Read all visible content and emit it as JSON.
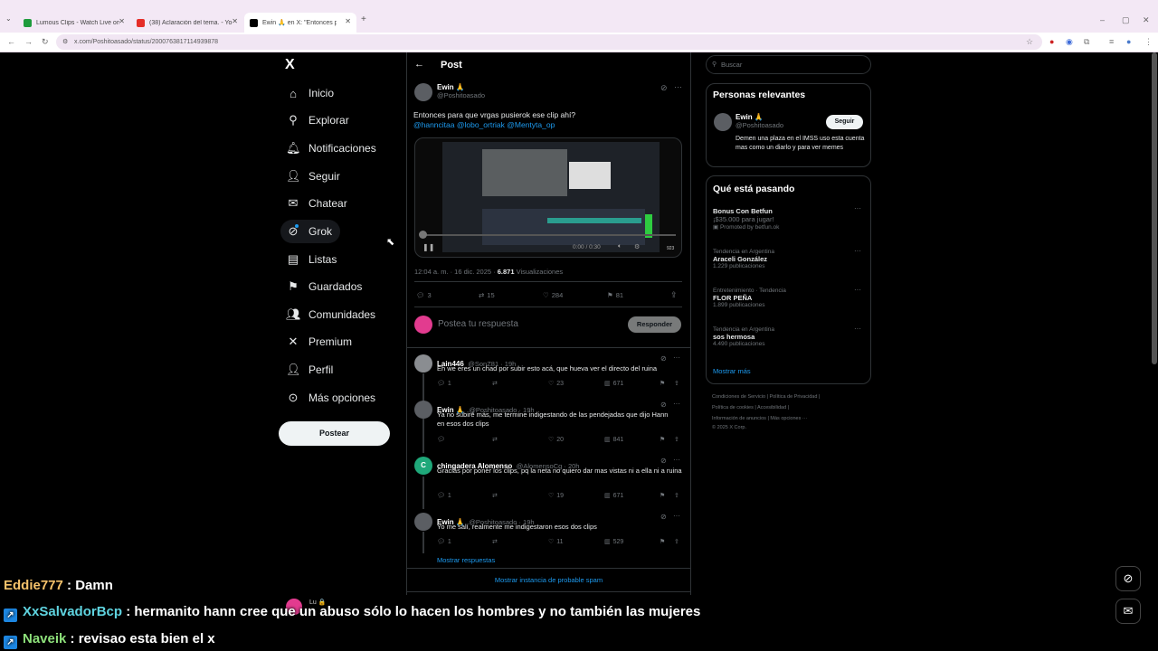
{
  "browser": {
    "tabs": [
      {
        "title": "Lumous Clips - Watch Live on X"
      },
      {
        "title": "(38) Aclaración del tema. - YouTube"
      },
      {
        "title": "Ewin 🙏 en X: \"Entonces para que"
      }
    ],
    "url": "x.com/Poshitoasado/status/2000763817114939878"
  },
  "nav": {
    "logo": "X",
    "items": [
      "Inicio",
      "Explorar",
      "Notificaciones",
      "Seguir",
      "Chatear",
      "Grok",
      "Listas",
      "Guardados",
      "Comunidades",
      "Premium",
      "Perfil",
      "Más opciones"
    ],
    "post_label": "Postear"
  },
  "header": {
    "title": "Post"
  },
  "post": {
    "name": "Ewin 🙏",
    "handle": "@Poshitoasado",
    "text": "Entonces para que vrgas pusierok ese clip ahí?",
    "mentions": "@hanncitaa @lobo_ortriak @Mentyta_op",
    "video_time": "0:00 / 0:30",
    "video_count": "923",
    "timestamp": "12:04 a. m. · 16 dic. 2025 · ",
    "views": "6.871",
    "views_label": " Visualizaciones",
    "replies": "3",
    "reposts": "15",
    "likes": "284",
    "bookmarks": "81"
  },
  "composer": {
    "placeholder": "Postea tu respuesta",
    "button": "Responder"
  },
  "replies": [
    {
      "name": "Lain446",
      "meta": "@SonZ81 · 19h",
      "text": "Eh we eres un chad por subir esto acá, que hueva ver el directo del ruina",
      "replies": "1",
      "reposts": "",
      "likes": "23",
      "views": "671"
    },
    {
      "name": "Ewin 🙏",
      "meta": "@Poshitoasado · 19h",
      "text": "Ya no subiré más, me termine indigestando de las pendejadas que dijo Hann en esos dos clips",
      "replies": "",
      "reposts": "",
      "likes": "20",
      "views": "841"
    },
    {
      "name": "chingadera Alomenso",
      "meta": "@AlomensoCg · 20h",
      "text": "Gracias por poner los clips, pq la neta no quiero dar mas vistas ni a ella ni a ruina",
      "replies": "1",
      "reposts": "",
      "likes": "19",
      "views": "671"
    },
    {
      "name": "Ewin 🙏",
      "meta": "@Poshitoasado · 19h",
      "text": "Yo me salí, realmente me indigestaron esos dos clips",
      "replies": "1",
      "reposts": "",
      "likes": "11",
      "views": "529"
    }
  ],
  "show_replies": "Mostrar respuestas",
  "spam_link": "Mostrar instancia de probable spam",
  "search": {
    "placeholder": "Buscar"
  },
  "relevant": {
    "title": "Personas relevantes",
    "name": "Ewin 🙏",
    "handle": "@Poshitoasado",
    "follow": "Seguir",
    "bio": "Demen una plaza en el IMSS uso esta cuenta mas como un diarlo y para ver memes"
  },
  "trends": {
    "title": "Qué está pasando",
    "items": [
      {
        "category": "",
        "name": "Bonus Con Betfun",
        "sub": "¡$35.000 para jugar!",
        "count": "Promoted by betfun.ok"
      },
      {
        "category": "Tendencia en Argentina",
        "name": "Araceli González",
        "sub": "",
        "count": "1.229 publicaciones"
      },
      {
        "category": "Entretenimiento · Tendencia",
        "name": "FLOR PEÑA",
        "sub": "",
        "count": "1.899 publicaciones"
      },
      {
        "category": "Tendencia en Argentina",
        "name": "sos hermosa",
        "sub": "",
        "count": "4.490 publicaciones"
      }
    ],
    "more": "Mostrar más"
  },
  "footer": {
    "line1": "Condiciones de Servicio  |  Política de Privacidad  |",
    "line2": "Política de cookies  |  Accesibilidad  |",
    "line3": "Información de anuncios  |  Más opciones ···",
    "line4": "© 2025 X Corp."
  },
  "chat": [
    {
      "user": "Eddie777",
      "text": " : Damn"
    },
    {
      "user": "XxSalvadorBcp",
      "text": " : hermanito hann cree que un abuso sólo lo hacen los hombres y no también las mujeres"
    },
    {
      "user": "Naveik",
      "text": " : revisao esta bien el x"
    }
  ],
  "overlay_label": "Lu 🔒",
  "colors": {
    "accent": "#1d9bf0",
    "background": "#000000",
    "border": "#2f3336"
  }
}
